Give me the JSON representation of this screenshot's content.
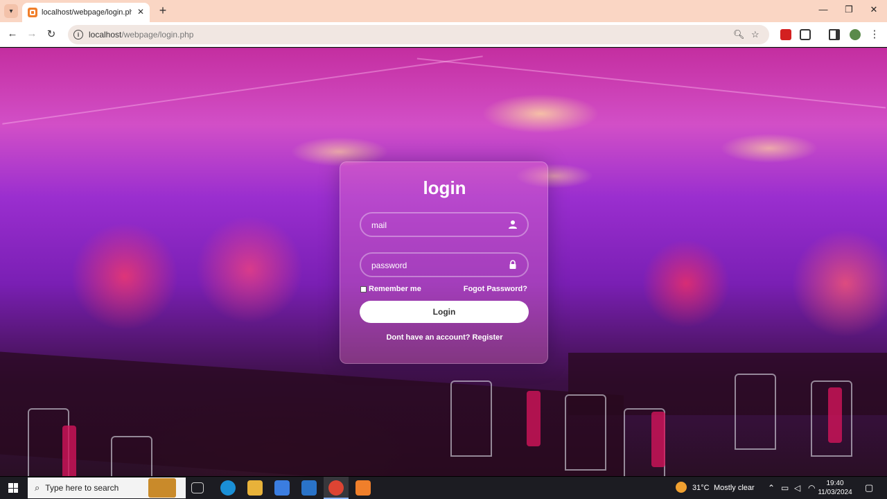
{
  "browser": {
    "tab_title": "localhost/webpage/login.php",
    "url_host": "localhost",
    "url_path": "/webpage/login.php",
    "new_tab_label": "+",
    "close_tab_label": "✕"
  },
  "login": {
    "title": "login",
    "email_placeholder": "mail",
    "password_placeholder": "password",
    "remember_label": "Remember me",
    "forgot_label": "Fogot Password?",
    "button_label": "Login",
    "no_account_text": "Dont have an account?",
    "register_label": "Register"
  },
  "taskbar": {
    "search_placeholder": "Type here to search",
    "temperature": "31°C",
    "weather": "Mostly clear",
    "time": "19:40",
    "date": "11/03/2024"
  },
  "colors": {
    "tabbar": "#fad6c4",
    "card_tint": "#f078c8",
    "taskbar": "#1c1c22"
  }
}
